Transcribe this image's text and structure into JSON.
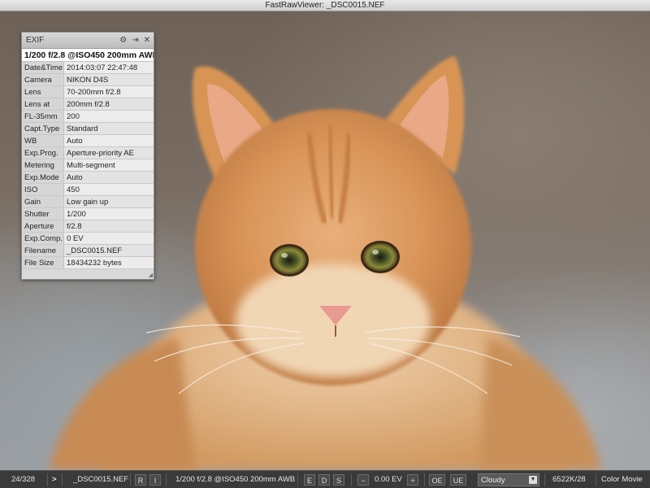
{
  "window": {
    "title": "FastRawViewer: _DSC0015.NEF"
  },
  "exif_panel": {
    "title": "EXIF",
    "icons": [
      "gear-icon",
      "detach-icon",
      "close-icon"
    ],
    "summary": "1/200 f/2.8 @ISO450 200mm AWB",
    "rows": [
      {
        "key": "Date&Time",
        "value": "2014:03:07 22:47:48"
      },
      {
        "key": "Camera",
        "value": "NIKON D4S"
      },
      {
        "key": "Lens",
        "value": "70-200mm f/2.8"
      },
      {
        "key": "Lens at",
        "value": "200mm f/2.8"
      },
      {
        "key": "FL-35mm",
        "value": "200"
      },
      {
        "key": "Capt.Type",
        "value": "Standard"
      },
      {
        "key": "WB",
        "value": "Auto"
      },
      {
        "key": "Exp.Prog.",
        "value": "Aperture-priority AE"
      },
      {
        "key": "Metering",
        "value": "Multi-segment"
      },
      {
        "key": "Exp.Mode",
        "value": "Auto"
      },
      {
        "key": "ISO",
        "value": "450"
      },
      {
        "key": "Gain",
        "value": "Low gain up"
      },
      {
        "key": "Shutter",
        "value": "1/200"
      },
      {
        "key": "Aperture",
        "value": "f/2.8"
      },
      {
        "key": "Exp.Comp.",
        "value": "0 EV"
      },
      {
        "key": "Filename",
        "value": "_DSC0015.NEF"
      },
      {
        "key": "File Size",
        "value": "18434232 bytes"
      }
    ]
  },
  "statusbar": {
    "counter": "24/328",
    "next": ">",
    "filename": "_DSC0015.NEF",
    "r_btn": "R",
    "i_btn": "I",
    "summary": "1/200 f/2.8 @ISO450 200mm AWB",
    "e_btn": "E",
    "d_btn": "D",
    "s_btn": "S",
    "minus": "−",
    "ev": "0.00 EV",
    "plus": "+",
    "oe_btn": "OE",
    "ue_btn": "UE",
    "wb_selected": "Cloudy",
    "temp": "6522K/28",
    "profile": "Color Movie"
  }
}
